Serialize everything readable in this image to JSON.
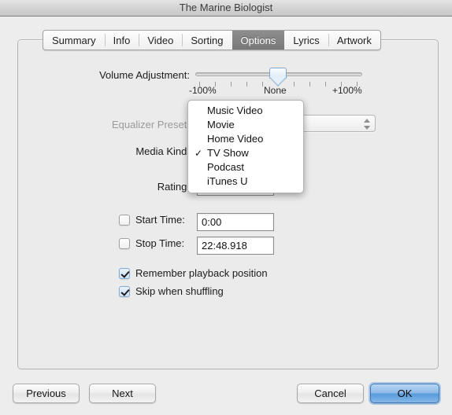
{
  "window": {
    "title": "The Marine Biologist"
  },
  "tabs": [
    {
      "label": "Summary",
      "selected": false
    },
    {
      "label": "Info",
      "selected": false
    },
    {
      "label": "Video",
      "selected": false
    },
    {
      "label": "Sorting",
      "selected": false
    },
    {
      "label": "Options",
      "selected": true
    },
    {
      "label": "Lyrics",
      "selected": false
    },
    {
      "label": "Artwork",
      "selected": false
    }
  ],
  "options": {
    "volume": {
      "label": "Volume Adjustment:",
      "min_label": "-100%",
      "mid_label": "None",
      "max_label": "+100%",
      "value": "None",
      "tick_count": 11
    },
    "equalizer": {
      "label": "Equalizer Preset:",
      "value": "",
      "enabled": false
    },
    "media_kind": {
      "label": "Media Kind:",
      "value": "TV Show",
      "menu_open": true,
      "options": [
        {
          "label": "Music Video",
          "checked": false
        },
        {
          "label": "Movie",
          "checked": false
        },
        {
          "label": "Home Video",
          "checked": false
        },
        {
          "label": "TV Show",
          "checked": true
        },
        {
          "label": "Podcast",
          "checked": false
        },
        {
          "label": "iTunes U",
          "checked": false
        }
      ],
      "check_glyph": "✓"
    },
    "rating": {
      "label": "Rating:",
      "value": ""
    },
    "start_time": {
      "label": "Start Time:",
      "value": "0:00",
      "checked": false
    },
    "stop_time": {
      "label": "Stop Time:",
      "value": "22:48.918",
      "checked": false
    },
    "remember_playback": {
      "label": "Remember playback position",
      "checked": true
    },
    "skip_shuffling": {
      "label": "Skip when shuffling",
      "checked": true
    }
  },
  "footer": {
    "previous": "Previous",
    "next": "Next",
    "cancel": "Cancel",
    "ok": "OK"
  },
  "colors": {
    "accent": "#579bdc",
    "selected_tab": "#787878",
    "window_bg": "#ededed",
    "panel_bg": "#ebebeb"
  }
}
